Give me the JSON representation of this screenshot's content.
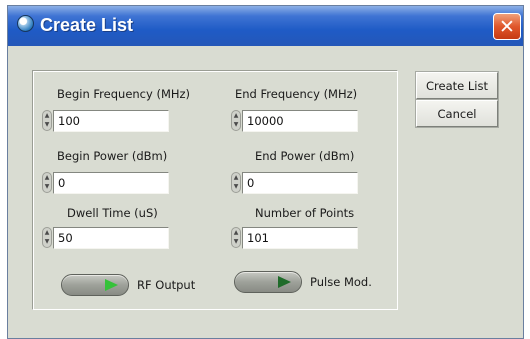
{
  "window": {
    "title": "Create List",
    "close_glyph": "✕"
  },
  "fields": {
    "begin_frequency": {
      "label": "Begin Frequency (MHz)",
      "value": "100"
    },
    "end_frequency": {
      "label": "End Frequency (MHz)",
      "value": "10000"
    },
    "begin_power": {
      "label": "Begin Power (dBm)",
      "value": "0"
    },
    "end_power": {
      "label": "End Power (dBm)",
      "value": "0"
    },
    "dwell_time": {
      "label": "Dwell Time (uS)",
      "value": "50"
    },
    "num_points": {
      "label": "Number of Points",
      "value": "101"
    }
  },
  "toggles": {
    "rf_output": {
      "label": "RF Output",
      "led_color": "#35c23a"
    },
    "pulse_mod": {
      "label": "Pulse Mod.",
      "led_color": "#1f6b2a"
    }
  },
  "buttons": {
    "create_list": "Create List",
    "cancel": "Cancel"
  },
  "spinner_glyphs": {
    "up": "▲",
    "down": "▼"
  },
  "colors": {
    "title_bar": "#2457b8",
    "dialog_bg": "#d9dcd2",
    "close_button": "#e0572b"
  }
}
